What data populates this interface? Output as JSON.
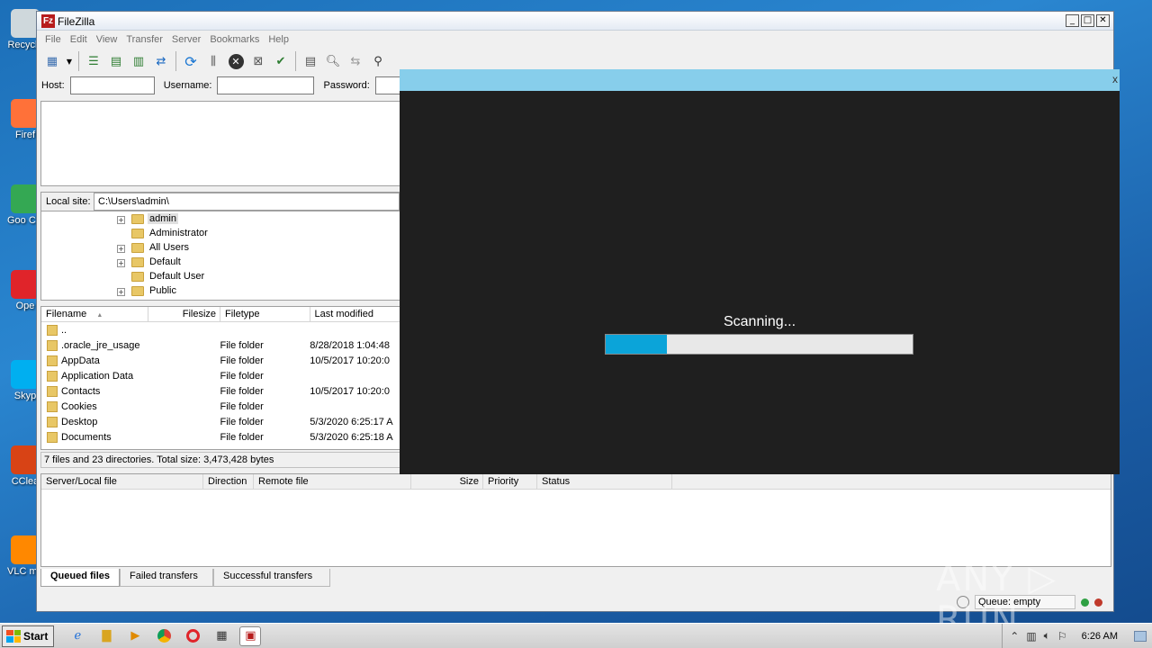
{
  "window": {
    "title": "FileZilla",
    "app_icon": "Fz"
  },
  "menu": [
    "File",
    "Edit",
    "View",
    "Transfer",
    "Server",
    "Bookmarks",
    "Help"
  ],
  "quickconnect": {
    "host_label": "Host:",
    "username_label": "Username:",
    "password_label": "Password:",
    "host_value": "",
    "username_value": ""
  },
  "local_site": {
    "label": "Local site:",
    "path": "C:\\Users\\admin\\"
  },
  "tree": [
    {
      "label": "admin",
      "expander": "+",
      "selected": true
    },
    {
      "label": "Administrator",
      "expander": ""
    },
    {
      "label": "All Users",
      "expander": "+"
    },
    {
      "label": "Default",
      "expander": "+"
    },
    {
      "label": "Default User",
      "expander": ""
    },
    {
      "label": "Public",
      "expander": "+"
    }
  ],
  "file_columns": {
    "filename": "Filename",
    "filesize": "Filesize",
    "filetype": "Filetype",
    "last_modified": "Last modified"
  },
  "files": [
    {
      "name": "..",
      "type": "",
      "modified": ""
    },
    {
      "name": ".oracle_jre_usage",
      "type": "File folder",
      "modified": "8/28/2018 1:04:48"
    },
    {
      "name": "AppData",
      "type": "File folder",
      "modified": "10/5/2017 10:20:0"
    },
    {
      "name": "Application Data",
      "type": "File folder",
      "modified": ""
    },
    {
      "name": "Contacts",
      "type": "File folder",
      "modified": "10/5/2017 10:20:0"
    },
    {
      "name": "Cookies",
      "type": "File folder",
      "modified": ""
    },
    {
      "name": "Desktop",
      "type": "File folder",
      "modified": "5/3/2020 6:25:17 A"
    },
    {
      "name": "Documents",
      "type": "File folder",
      "modified": "5/3/2020 6:25:18 A"
    }
  ],
  "local_status": "7 files and 23 directories. Total size: 3,473,428 bytes",
  "queue_columns": {
    "server_local": "Server/Local file",
    "direction": "Direction",
    "remote": "Remote file",
    "size": "Size",
    "priority": "Priority",
    "status": "Status"
  },
  "queue_tabs": [
    "Queued files",
    "Failed transfers",
    "Successful transfers"
  ],
  "queue_status": "Queue: empty",
  "overlay": {
    "close": "x",
    "message": "Scanning...",
    "progress_fraction": 0.2
  },
  "desktop_icons": [
    {
      "label": "Recycle",
      "color": "#cfd8dc"
    },
    {
      "label": "Firef",
      "color": "#ff7139"
    },
    {
      "label": "Goo Chro",
      "color": "#34a853"
    },
    {
      "label": "Ope",
      "color": "#e0242a"
    },
    {
      "label": "Skyp",
      "color": "#00aff0"
    },
    {
      "label": "CClea",
      "color": "#d84315"
    },
    {
      "label": "VLC m play",
      "color": "#ff8800"
    }
  ],
  "taskbar": {
    "start_label": "Start",
    "clock": "6:26 AM"
  },
  "watermark": "ANY ▷ RUN"
}
